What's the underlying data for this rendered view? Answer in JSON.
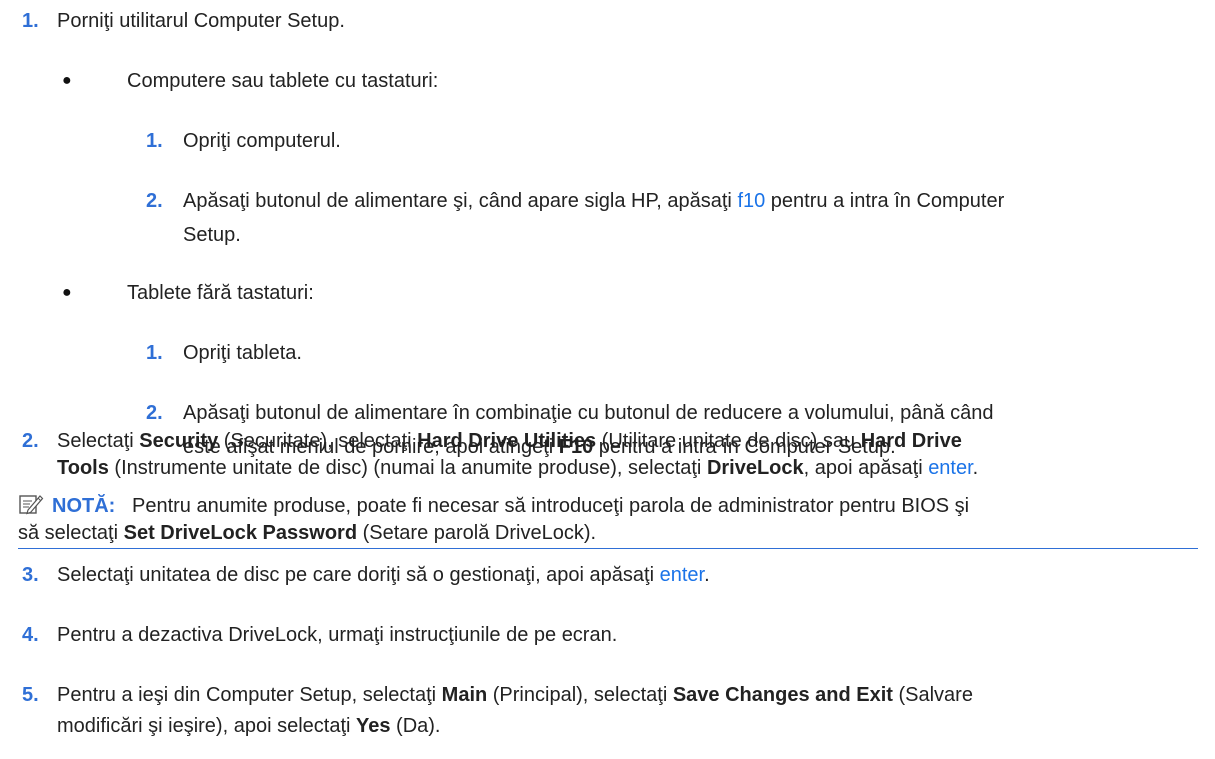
{
  "steps": [
    {
      "num": "1.",
      "text": "Porniţi utilitarul Computer Setup.",
      "groups": [
        {
          "bullet": "●",
          "title": "Computere sau tablete cu tastaturi:",
          "substeps": [
            {
              "num": "1.",
              "text": "Opriţi computerul."
            },
            {
              "num": "2.",
              "line1_pre": "Apăsaţi butonul de alimentare şi, când apare sigla HP, apăsaţi ",
              "line1_key": "f10",
              "line1_post": " pentru a intra în Computer",
              "line2": "Setup."
            }
          ]
        },
        {
          "bullet": "●",
          "title": "Tablete fără tastaturi:",
          "substeps": [
            {
              "num": "1.",
              "text": "Opriţi tableta."
            },
            {
              "num": "2.",
              "line1": "Apăsaţi butonul de alimentare în combinaţie cu butonul de reducere a volumului, până când",
              "line2_pre": "este afişat meniul de pornire, apoi atingeţi ",
              "line2_bold": "F10",
              "line2_post": " pentru a intra în Computer Setup."
            }
          ]
        }
      ]
    },
    {
      "num": "2.",
      "l1_a": "Selectaţi ",
      "l1_b1": "Security",
      "l1_c": " (Securitate), selectaţi ",
      "l1_b2": "Hard Drive Utilities",
      "l1_d": " (Utilitare unitate de disc) sau ",
      "l1_b3": "Hard Drive",
      "l2_b1": "Tools",
      "l2_a": " (Instrumente unitate de disc) (numai la anumite produse), selectaţi ",
      "l2_b2": "DriveLock",
      "l2_c": ", apoi apăsaţi ",
      "l2_key": "enter",
      "l2_end": "."
    },
    {
      "num": "3.",
      "pre": "Selectaţi unitatea de disc pe care doriţi să o gestionaţi, apoi apăsaţi ",
      "key": "enter",
      "post": "."
    },
    {
      "num": "4.",
      "text": "Pentru a dezactiva DriveLock, urmaţi instrucţiunile de pe ecran."
    },
    {
      "num": "5.",
      "l1_a": "Pentru a ieşi din Computer Setup, selectaţi ",
      "l1_b1": "Main",
      "l1_c": " (Principal), selectaţi ",
      "l1_b2": "Save Changes and Exit",
      "l1_d": " (Salvare",
      "l2_a": "modificări şi ieşire), apoi selectaţi ",
      "l2_b": "Yes",
      "l2_c": " (Da)."
    }
  ],
  "note": {
    "label": "NOTĂ:",
    "l1": "Pentru anumite produse, poate fi necesar să introduceţi parola de administrator pentru BIOS şi",
    "l2_pre": "să selectaţi ",
    "l2_bold": "Set DriveLock Password",
    "l2_post": " (Setare parolă DriveLock)."
  },
  "colors": {
    "accent": "#2f6fd6",
    "key": "#1a73e8",
    "text": "#222222"
  },
  "icons": {
    "note": "note-pencil-icon"
  }
}
